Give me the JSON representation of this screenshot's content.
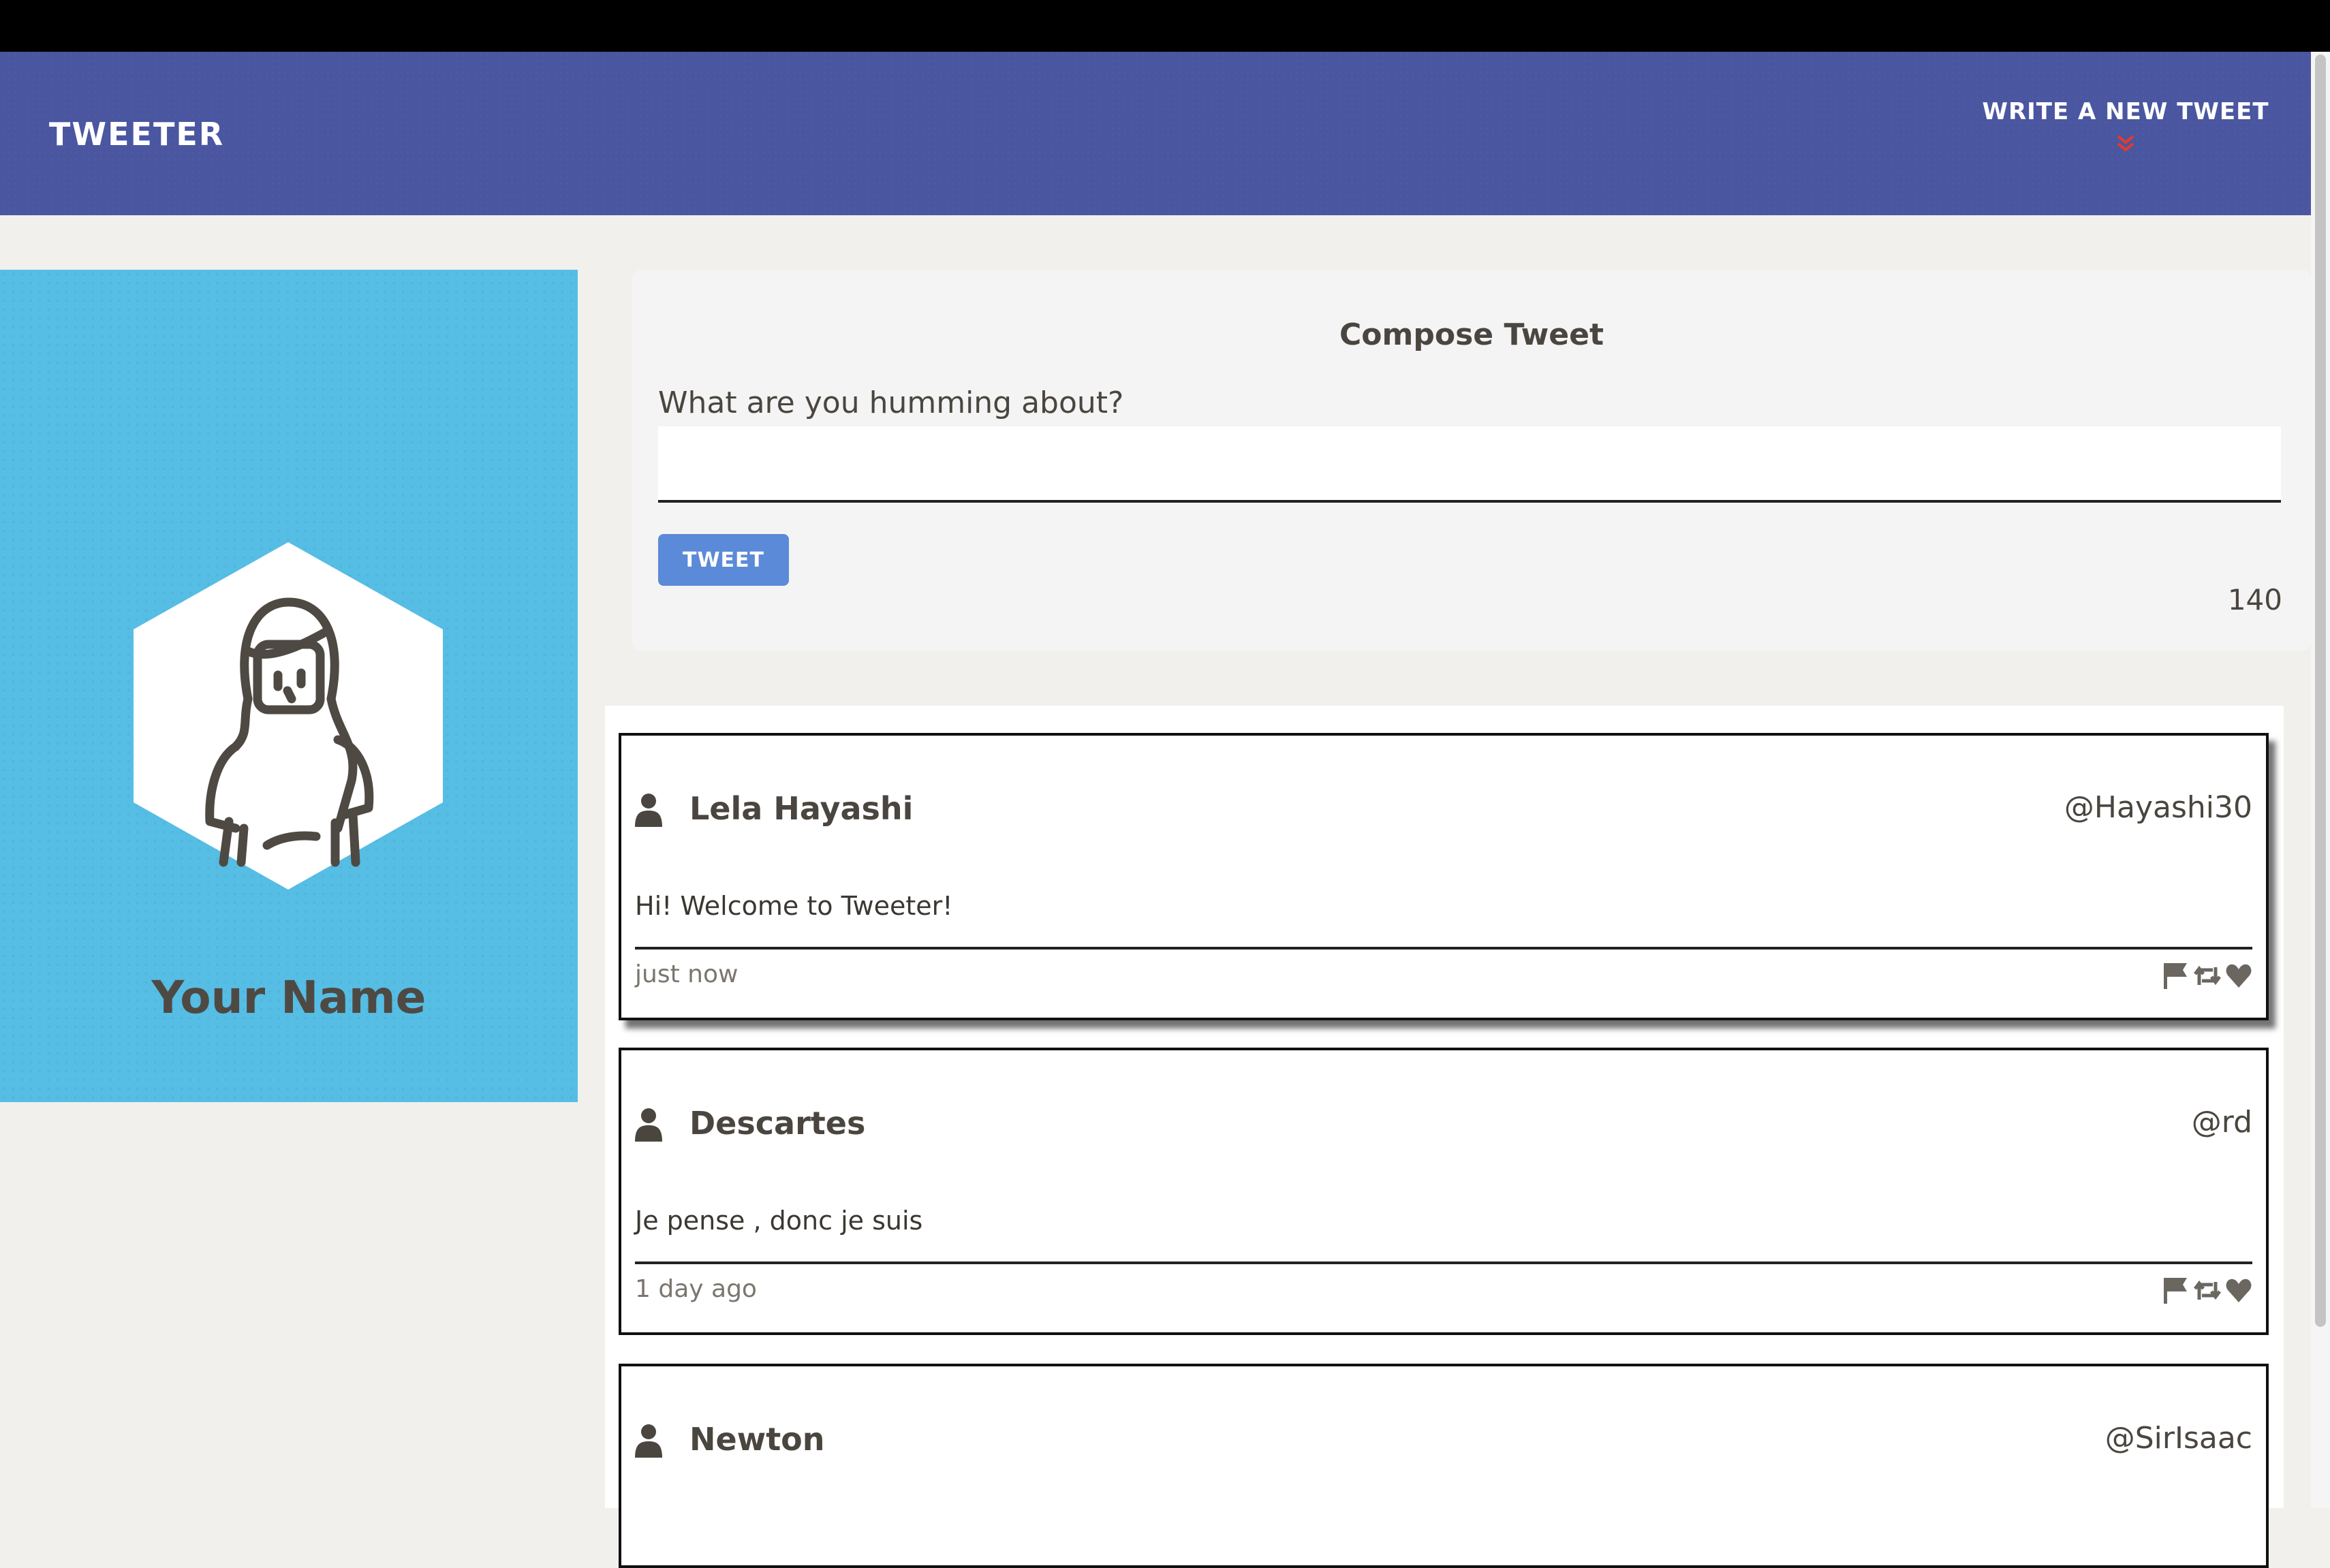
{
  "app": {
    "brand": "TWEETER"
  },
  "nav": {
    "compose_toggle": "WRITE A NEW TWEET",
    "compose_chevron": "»"
  },
  "profile": {
    "name": "Your Name",
    "avatar_icon": "woman-avatar-icon"
  },
  "composer": {
    "title": "Compose Tweet",
    "prompt": "What are you humming about?",
    "input_value": "",
    "button_label": "TWEET",
    "char_count": "140"
  },
  "tweets": [
    {
      "name": "Lela Hayashi",
      "handle": "@Hayashi30",
      "text": "Hi! Welcome to Tweeter!",
      "time": "just now"
    },
    {
      "name": "Descartes",
      "handle": "@rd",
      "text": "Je pense , donc je suis",
      "time": "1 day ago"
    },
    {
      "name": "Newton",
      "handle": "@SirIsaac",
      "text": "",
      "time": ""
    }
  ],
  "colors": {
    "nav": "#4a56a0",
    "profile_bg": "#56bde4",
    "button": "#5b8ad8",
    "chevron": "#e6392b",
    "page_bg": "#f1f0ec"
  }
}
